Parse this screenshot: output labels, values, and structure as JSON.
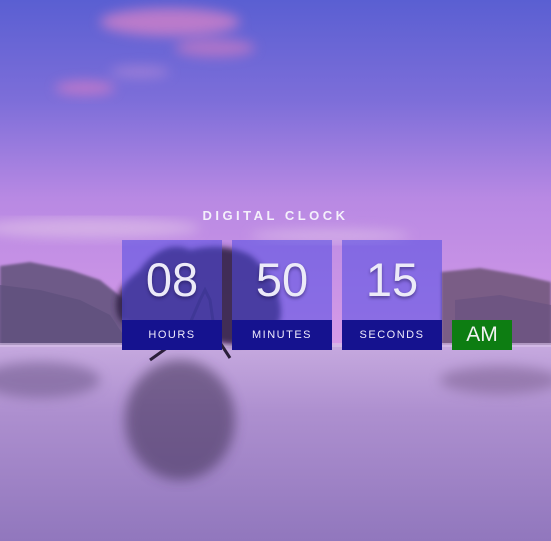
{
  "clock": {
    "title": "DIGITAL CLOCK",
    "units": [
      {
        "value": "08",
        "label": "HOURS"
      },
      {
        "value": "50",
        "label": "MINUTES"
      },
      {
        "value": "15",
        "label": "SECONDS"
      }
    ],
    "period": "AM"
  },
  "colors": {
    "digit_box": "#504be1",
    "label_box": "#15128f",
    "period_box": "#0d7d12"
  }
}
